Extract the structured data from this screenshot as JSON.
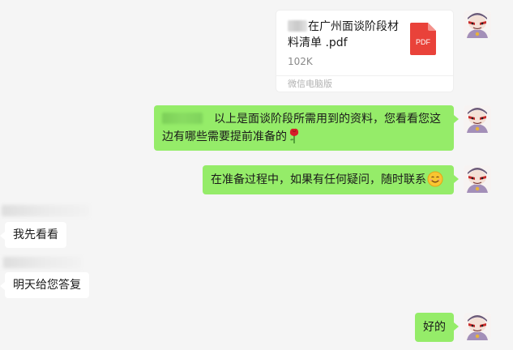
{
  "file_message": {
    "file_name": "在广州面谈阶段材料清单 .pdf",
    "file_size": "102K",
    "source": "微信电脑版",
    "icon_label": "PDF",
    "icon": "pdf-file-icon"
  },
  "messages": [
    {
      "side": "right",
      "text": "以上是面谈阶段所需用到的资料，您看看您这边有哪些需要提前准备的",
      "emoji": "rose-icon"
    },
    {
      "side": "right",
      "text": "在准备过程中，如果有任何疑问，随时联系",
      "emoji": "smile-icon"
    },
    {
      "side": "left",
      "text": "我先看看"
    },
    {
      "side": "left",
      "text": "明天给您答复"
    },
    {
      "side": "right",
      "text": "好的"
    }
  ],
  "colors": {
    "background": "#f5f5f5",
    "self_bubble": "#95ec69",
    "other_bubble": "#ffffff",
    "pdf_red": "#e9423a"
  }
}
